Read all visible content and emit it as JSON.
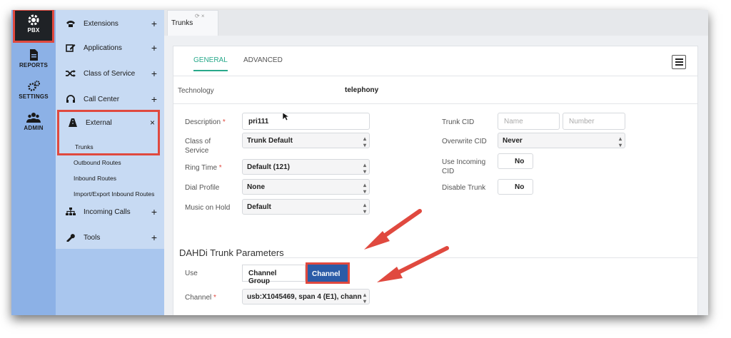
{
  "rail": {
    "items": [
      {
        "label": "PBX",
        "icon": "gear-icon"
      },
      {
        "label": "REPORTS",
        "icon": "document-icon"
      },
      {
        "label": "SETTINGS",
        "icon": "settings-gears-icon"
      },
      {
        "label": "ADMIN",
        "icon": "users-icon"
      }
    ]
  },
  "menu": {
    "extensions": "Extensions",
    "applications": "Applications",
    "class_of_service": "Class of Service",
    "call_center": "Call Center",
    "external": "External",
    "external_close": "×",
    "plus": "+",
    "sub": [
      "Trunks",
      "Outbound Routes",
      "Inbound Routes",
      "Import/Export Inbound Routes"
    ],
    "incoming_calls": "Incoming Calls",
    "tools": "Tools"
  },
  "tabbar": {
    "tab_label": "Trunks",
    "tab_controls": "⟳ ×"
  },
  "form": {
    "tabs": [
      "GENERAL",
      "ADVANCED"
    ],
    "technology_label": "Technology",
    "technology_value": "telephony",
    "description_label": "Description",
    "description_value": "pri111",
    "required_mark": "*",
    "cos_label": "Class of Service",
    "cos_value": "Trunk Default",
    "ring_label": "Ring Time",
    "ring_value": "Default (121)",
    "dial_label": "Dial Profile",
    "dial_value": "None",
    "moh_label": "Music on Hold",
    "moh_value": "Default",
    "trunk_cid_label": "Trunk CID",
    "trunk_cid_name_placeholder": "Name",
    "trunk_cid_number_placeholder": "Number",
    "overwrite_cid_label": "Overwrite CID",
    "overwrite_cid_value": "Never",
    "use_incoming_cid_label": "Use Incoming CID",
    "use_incoming_cid_value": "No",
    "disable_trunk_label": "Disable Trunk",
    "disable_trunk_value": "No",
    "section_title": "DAHDi Trunk Parameters",
    "use_label": "Use",
    "use_options": [
      "Channel Group",
      "Channel"
    ],
    "channel_label": "Channel",
    "channel_value": "usb:X1045469, span 4 (E1), chann"
  },
  "colors": {
    "accent": "#29a98b",
    "highlight": "#e0493f",
    "active_button": "#2b5ba7",
    "rail": "#8cb1e6"
  }
}
